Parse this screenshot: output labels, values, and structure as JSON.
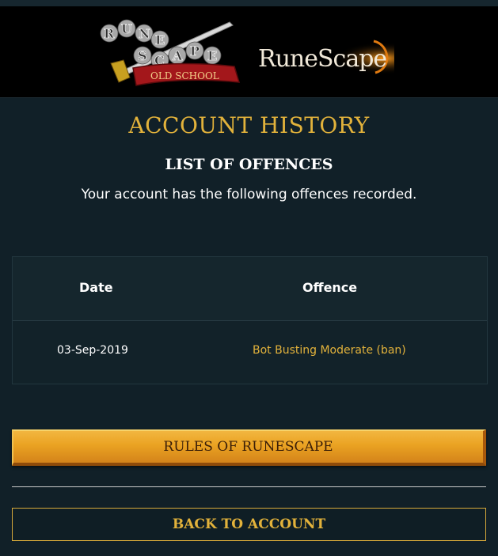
{
  "header": {
    "osrs_logo_text": "RuneScape Old School",
    "osrs_logo_banner": "OLD SCHOOL",
    "rs_logo_text": "RuneScape"
  },
  "main": {
    "title": "ACCOUNT HISTORY",
    "subtitle": "LIST OF OFFENCES",
    "description": "Your account has the following offences recorded."
  },
  "table": {
    "headers": {
      "date": "Date",
      "offence": "Offence"
    },
    "rows": [
      {
        "date": "03-Sep-2019",
        "offence": "Bot Busting Moderate (ban)"
      }
    ]
  },
  "actions": {
    "rules_label": "RULES OF RUNESCAPE",
    "back_label": "BACK TO ACCOUNT"
  },
  "colors": {
    "accent_gold": "#e2b23b",
    "background": "#112028",
    "header_black": "#000000"
  }
}
